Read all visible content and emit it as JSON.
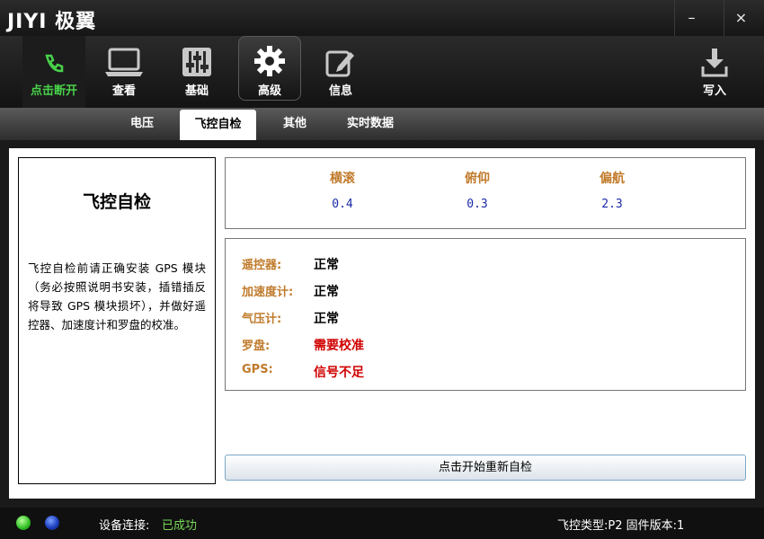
{
  "app": {
    "logo_text": "JIYI 极翼"
  },
  "window": {
    "minimize": "–",
    "close": "×"
  },
  "toolbar": {
    "items": [
      {
        "label": "点击断开",
        "icon": "phone-connect-icon",
        "color": "#48d14a"
      },
      {
        "label": "查看",
        "icon": "laptop-icon"
      },
      {
        "label": "基础",
        "icon": "sliders-icon"
      },
      {
        "label": "高级",
        "icon": "gear-icon",
        "active": true
      },
      {
        "label": "信息",
        "icon": "edit-icon"
      }
    ],
    "write_label": "写入"
  },
  "tabs": [
    "电压",
    "飞控自检",
    "其他",
    "实时数据"
  ],
  "active_tab": "飞控自检",
  "left_panel": {
    "title": "飞控自检",
    "description": "飞控自检前请正确安装 GPS 模块（务必按照说明书安装，插错插反将导致 GPS 模块损坏），并做好遥控器、加速度计和罗盘的校准。"
  },
  "attitude": [
    {
      "name": "横滚",
      "value": "0.4"
    },
    {
      "name": "俯仰",
      "value": "0.3"
    },
    {
      "name": "偏航",
      "value": "2.3"
    }
  ],
  "checks": [
    {
      "key": "遥控器:",
      "value": "正常",
      "status": "ok"
    },
    {
      "key": "加速度计:",
      "value": "正常",
      "status": "ok"
    },
    {
      "key": "气压计:",
      "value": "正常",
      "status": "ok"
    },
    {
      "key": "罗盘:",
      "value": "需要校准",
      "status": "error"
    },
    {
      "key": "GPS:",
      "value": "信号不足",
      "status": "error"
    }
  ],
  "restart_button": "点击开始重新自检",
  "statusbar": {
    "connection_label": "设备连接:",
    "connection_value": "已成功",
    "fc_info": "飞控类型:P2 固件版本:1"
  },
  "colors": {
    "ok_text": "#000000",
    "error_text": "#d00000",
    "label_text": "#c07a2a",
    "value_text": "#1a2aa8"
  }
}
